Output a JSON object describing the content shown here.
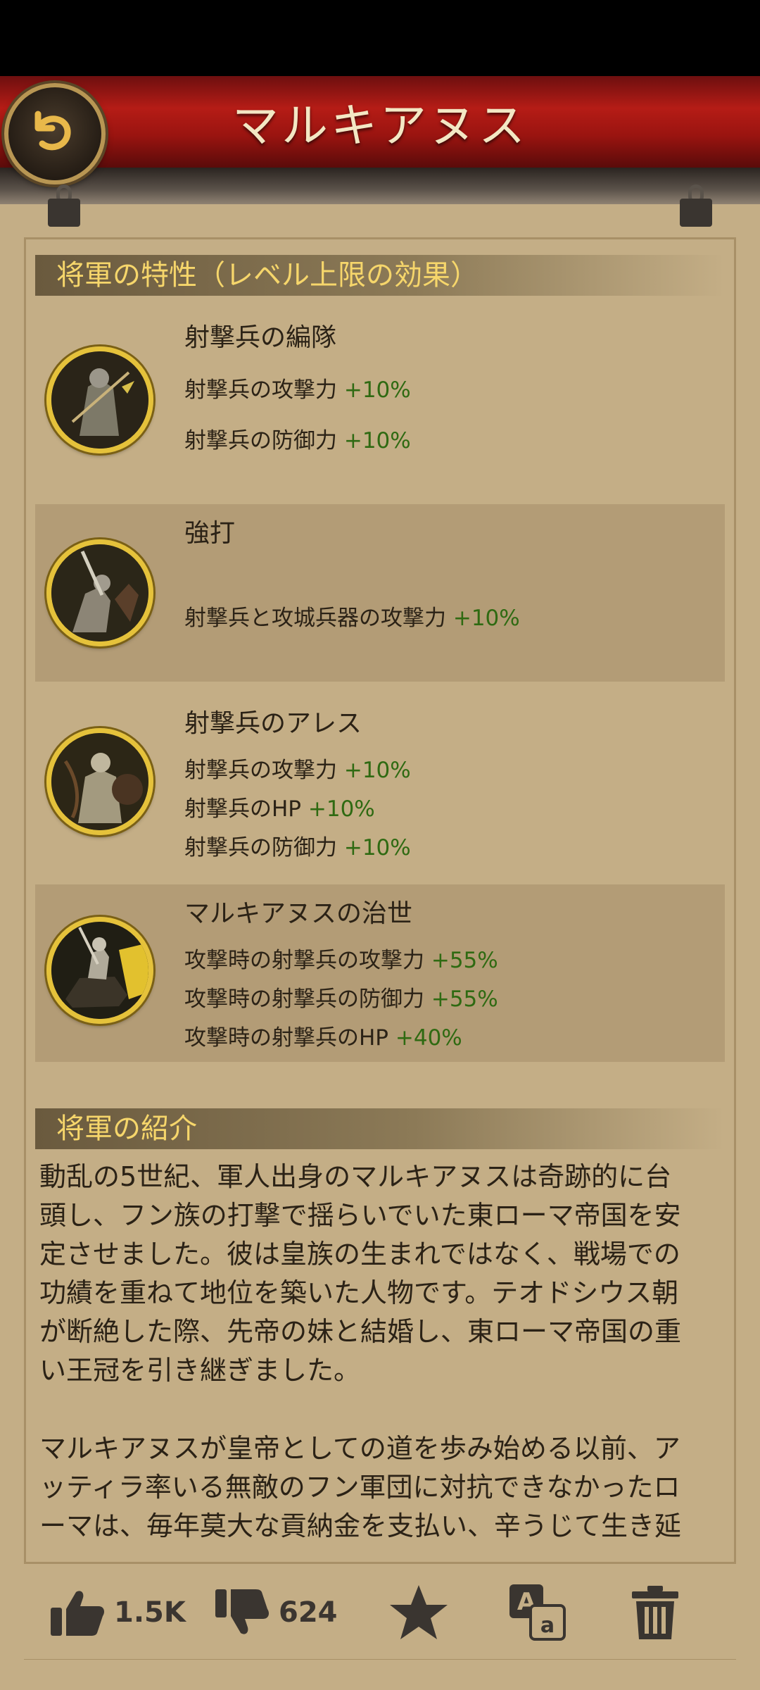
{
  "header": {
    "title": "マルキアヌス"
  },
  "traits": {
    "heading": "将軍の特性（レベル上限の効果）",
    "skills": [
      {
        "name": "射撃兵の編隊",
        "stats": [
          {
            "label": "射撃兵の攻撃力",
            "value": "+10%"
          },
          {
            "label": "射撃兵の防御力",
            "value": "+10%"
          }
        ]
      },
      {
        "name": "強打",
        "stats": [
          {
            "label": "射撃兵と攻城兵器の攻撃力",
            "value": "+10%"
          }
        ]
      },
      {
        "name": "射撃兵のアレス",
        "stats": [
          {
            "label": "射撃兵の攻撃力",
            "value": "+10%"
          },
          {
            "label": "射撃兵のHP",
            "value": "+10%"
          },
          {
            "label": "射撃兵の防御力",
            "value": "+10%"
          }
        ]
      },
      {
        "name": "マルキアヌスの治世",
        "stats": [
          {
            "label": "攻撃時の射撃兵の攻撃力",
            "value": "+55%"
          },
          {
            "label": "攻撃時の射撃兵の防御力",
            "value": "+55%"
          },
          {
            "label": "攻撃時の射撃兵のHP",
            "value": "+40%"
          }
        ]
      }
    ]
  },
  "intro": {
    "heading": "将軍の紹介",
    "p1_lines": [
      "動乱の5世紀、軍人出身のマルキアヌスは奇跡的に台",
      "頭し、フン族の打撃で揺らいでいた東ローマ帝国を安",
      "定させました。彼は皇族の生まれではなく、戦場での",
      "功績を重ねて地位を築いた人物です。テオドシウス朝",
      "が断絶した際、先帝の妹と結婚し、東ローマ帝国の重",
      "い王冠を引き継ぎました。"
    ],
    "p2_lines": [
      "マルキアヌスが皇帝としての道を歩み始める以前、ア",
      "ッティラ率いる無敵のフン軍団に対抗できなかったロ",
      "ーマは、毎年莫大な貢納金を支払い、辛うじて生き延"
    ]
  },
  "actions": {
    "likes": "1.5K",
    "dislikes": "624"
  },
  "colors": {
    "accent_gold": "#f6d66b",
    "stat_green": "#2f6a12",
    "banner_red": "#b51c16"
  }
}
